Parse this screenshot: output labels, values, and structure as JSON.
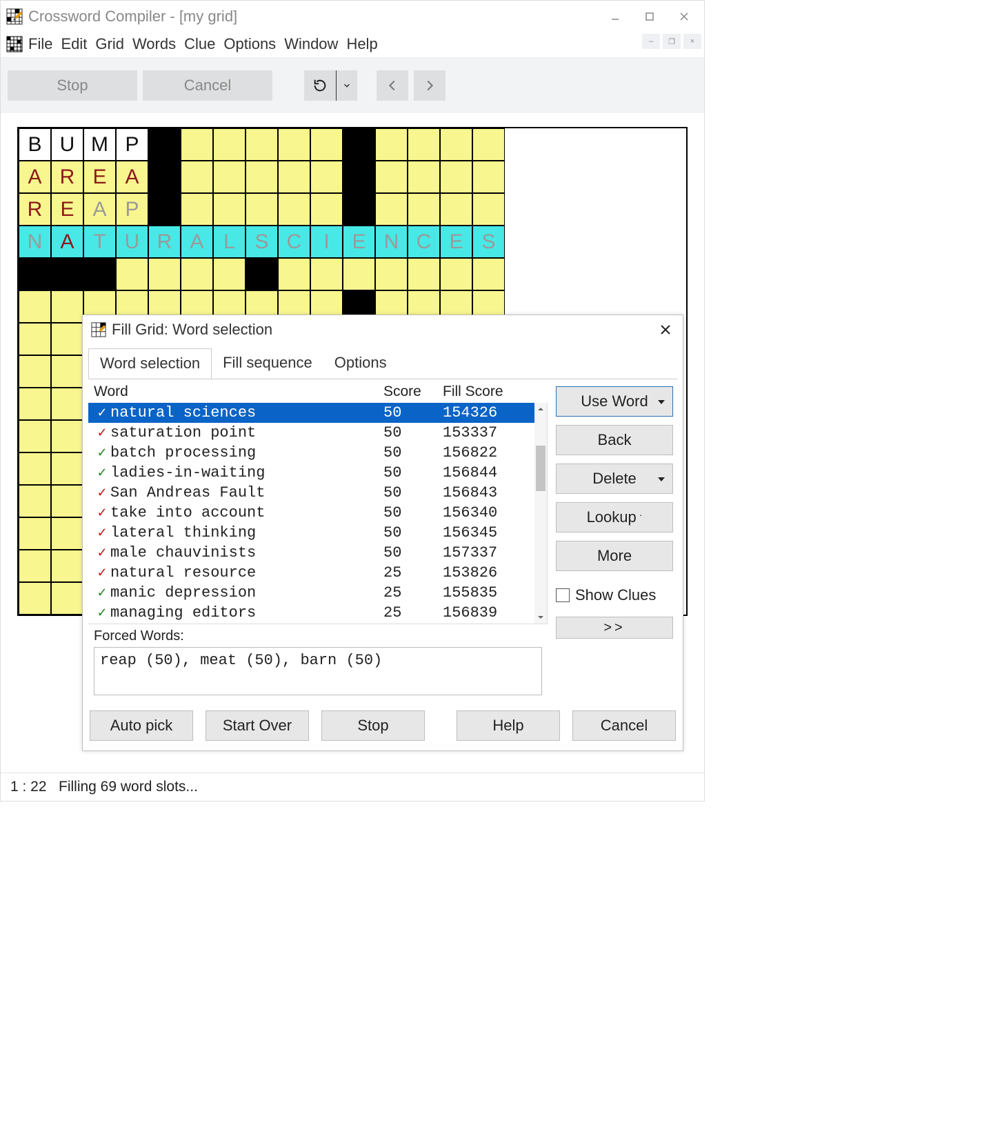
{
  "app": {
    "title": "Crossword Compiler - [my grid]"
  },
  "menu": {
    "items": [
      "File",
      "Edit",
      "Grid",
      "Words",
      "Clue",
      "Options",
      "Window",
      "Help"
    ]
  },
  "toolbar": {
    "stop": "Stop",
    "cancel": "Cancel"
  },
  "grid": {
    "rows": [
      [
        {
          "bg": "w",
          "t": "B",
          "c": "b"
        },
        {
          "bg": "w",
          "t": "U",
          "c": "b"
        },
        {
          "bg": "w",
          "t": "M",
          "c": "b"
        },
        {
          "bg": "w",
          "t": "P",
          "c": "b"
        },
        {
          "bg": "k"
        },
        {
          "bg": "y"
        },
        {
          "bg": "y"
        },
        {
          "bg": "y"
        },
        {
          "bg": "y"
        },
        {
          "bg": "y"
        },
        {
          "bg": "k"
        },
        {
          "bg": "y"
        },
        {
          "bg": "y"
        },
        {
          "bg": "y"
        },
        {
          "bg": "y"
        }
      ],
      [
        {
          "bg": "y",
          "t": "A",
          "c": "r"
        },
        {
          "bg": "y",
          "t": "R",
          "c": "r"
        },
        {
          "bg": "y",
          "t": "E",
          "c": "r"
        },
        {
          "bg": "y",
          "t": "A",
          "c": "r"
        },
        {
          "bg": "k"
        },
        {
          "bg": "y"
        },
        {
          "bg": "y"
        },
        {
          "bg": "y"
        },
        {
          "bg": "y"
        },
        {
          "bg": "y"
        },
        {
          "bg": "k"
        },
        {
          "bg": "y"
        },
        {
          "bg": "y"
        },
        {
          "bg": "y"
        },
        {
          "bg": "y"
        }
      ],
      [
        {
          "bg": "y",
          "t": "R",
          "c": "r"
        },
        {
          "bg": "y",
          "t": "E",
          "c": "r"
        },
        {
          "bg": "y",
          "t": "A",
          "c": "g"
        },
        {
          "bg": "y",
          "t": "P",
          "c": "g"
        },
        {
          "bg": "k"
        },
        {
          "bg": "y"
        },
        {
          "bg": "y"
        },
        {
          "bg": "y"
        },
        {
          "bg": "y"
        },
        {
          "bg": "y"
        },
        {
          "bg": "k"
        },
        {
          "bg": "y"
        },
        {
          "bg": "y"
        },
        {
          "bg": "y"
        },
        {
          "bg": "y"
        }
      ],
      [
        {
          "bg": "c",
          "t": "N",
          "c": "g"
        },
        {
          "bg": "c",
          "t": "A",
          "c": "r"
        },
        {
          "bg": "c",
          "t": "T",
          "c": "g"
        },
        {
          "bg": "c",
          "t": "U",
          "c": "g"
        },
        {
          "bg": "c",
          "t": "R",
          "c": "g"
        },
        {
          "bg": "c",
          "t": "A",
          "c": "g"
        },
        {
          "bg": "c",
          "t": "L",
          "c": "g"
        },
        {
          "bg": "c",
          "t": "S",
          "c": "g"
        },
        {
          "bg": "c",
          "t": "C",
          "c": "g"
        },
        {
          "bg": "c",
          "t": "I",
          "c": "g"
        },
        {
          "bg": "c",
          "t": "E",
          "c": "g"
        },
        {
          "bg": "c",
          "t": "N",
          "c": "g"
        },
        {
          "bg": "c",
          "t": "C",
          "c": "g"
        },
        {
          "bg": "c",
          "t": "E",
          "c": "g"
        },
        {
          "bg": "c",
          "t": "S",
          "c": "g"
        }
      ],
      [
        {
          "bg": "k"
        },
        {
          "bg": "k"
        },
        {
          "bg": "k"
        },
        {
          "bg": "y"
        },
        {
          "bg": "y"
        },
        {
          "bg": "y"
        },
        {
          "bg": "y"
        },
        {
          "bg": "k"
        },
        {
          "bg": "y"
        },
        {
          "bg": "y"
        },
        {
          "bg": "y"
        },
        {
          "bg": "y"
        },
        {
          "bg": "y"
        },
        {
          "bg": "y"
        },
        {
          "bg": "y"
        }
      ],
      [
        {
          "bg": "y"
        },
        {
          "bg": "y"
        },
        {
          "bg": "y"
        },
        {
          "bg": "y"
        },
        {
          "bg": "y"
        },
        {
          "bg": "y"
        },
        {
          "bg": "y"
        },
        {
          "bg": "y"
        },
        {
          "bg": "y"
        },
        {
          "bg": "y"
        },
        {
          "bg": "k"
        },
        {
          "bg": "y"
        },
        {
          "bg": "y"
        },
        {
          "bg": "y"
        },
        {
          "bg": "y"
        }
      ],
      [
        {
          "bg": "y"
        },
        {
          "bg": "y"
        },
        {
          "bg": "y"
        },
        {
          "bg": "y"
        },
        {
          "bg": "y"
        },
        {
          "bg": "k"
        },
        {
          "bg": "y"
        },
        {
          "bg": "y"
        },
        {
          "bg": "y"
        },
        {
          "bg": "y"
        },
        {
          "bg": "y"
        },
        {
          "bg": "y"
        },
        {
          "bg": "y"
        },
        {
          "bg": "y"
        },
        {
          "bg": "y"
        }
      ],
      [
        {
          "bg": "y"
        },
        {
          "bg": "y"
        },
        {
          "bg": "y"
        },
        {
          "bg": "y"
        },
        {
          "bg": "y"
        },
        {
          "bg": "y"
        },
        {
          "bg": "y"
        },
        {
          "bg": "k"
        },
        {
          "bg": "y"
        },
        {
          "bg": "y"
        },
        {
          "bg": "y"
        },
        {
          "bg": "y"
        },
        {
          "bg": "y"
        },
        {
          "bg": "y"
        },
        {
          "bg": "y"
        }
      ],
      [
        {
          "bg": "y"
        },
        {
          "bg": "y"
        },
        {
          "bg": "y"
        },
        {
          "bg": "y"
        },
        {
          "bg": "y"
        },
        {
          "bg": "y"
        },
        {
          "bg": "y"
        },
        {
          "bg": "y"
        },
        {
          "bg": "y"
        },
        {
          "bg": "k"
        },
        {
          "bg": "y"
        },
        {
          "bg": "y"
        },
        {
          "bg": "y"
        },
        {
          "bg": "y"
        },
        {
          "bg": "y"
        }
      ],
      [
        {
          "bg": "y"
        },
        {
          "bg": "y"
        },
        {
          "bg": "y"
        },
        {
          "bg": "y"
        },
        {
          "bg": "k"
        },
        {
          "bg": "y"
        },
        {
          "bg": "y"
        },
        {
          "bg": "y"
        },
        {
          "bg": "y"
        },
        {
          "bg": "y"
        },
        {
          "bg": "y"
        },
        {
          "bg": "y"
        },
        {
          "bg": "y"
        },
        {
          "bg": "y"
        },
        {
          "bg": "y"
        }
      ],
      [
        {
          "bg": "y"
        },
        {
          "bg": "y"
        },
        {
          "bg": "y"
        },
        {
          "bg": "y"
        },
        {
          "bg": "y"
        },
        {
          "bg": "y"
        },
        {
          "bg": "y"
        },
        {
          "bg": "k"
        },
        {
          "bg": "y"
        },
        {
          "bg": "y"
        },
        {
          "bg": "y"
        },
        {
          "bg": "y"
        },
        {
          "bg": "k"
        },
        {
          "bg": "k"
        },
        {
          "bg": "k"
        }
      ],
      [
        {
          "bg": "y"
        },
        {
          "bg": "y"
        },
        {
          "bg": "y"
        },
        {
          "bg": "y"
        },
        {
          "bg": "y"
        },
        {
          "bg": "y"
        },
        {
          "bg": "y"
        },
        {
          "bg": "y"
        },
        {
          "bg": "y"
        },
        {
          "bg": "y"
        },
        {
          "bg": "y"
        },
        {
          "bg": "y"
        },
        {
          "bg": "y"
        },
        {
          "bg": "y"
        },
        {
          "bg": "y"
        }
      ],
      [
        {
          "bg": "y"
        },
        {
          "bg": "y"
        },
        {
          "bg": "y"
        },
        {
          "bg": "y"
        },
        {
          "bg": "k"
        },
        {
          "bg": "y"
        },
        {
          "bg": "y"
        },
        {
          "bg": "y"
        },
        {
          "bg": "y"
        },
        {
          "bg": "y"
        },
        {
          "bg": "k"
        },
        {
          "bg": "y"
        },
        {
          "bg": "y"
        },
        {
          "bg": "y"
        },
        {
          "bg": "y"
        }
      ],
      [
        {
          "bg": "y"
        },
        {
          "bg": "y"
        },
        {
          "bg": "y"
        },
        {
          "bg": "y"
        },
        {
          "bg": "k"
        },
        {
          "bg": "y"
        },
        {
          "bg": "y"
        },
        {
          "bg": "y"
        },
        {
          "bg": "y"
        },
        {
          "bg": "y"
        },
        {
          "bg": "k"
        },
        {
          "bg": "y"
        },
        {
          "bg": "y"
        },
        {
          "bg": "y"
        },
        {
          "bg": "y"
        }
      ],
      [
        {
          "bg": "y"
        },
        {
          "bg": "y"
        },
        {
          "bg": "y"
        },
        {
          "bg": "y"
        },
        {
          "bg": "k"
        },
        {
          "bg": "y"
        },
        {
          "bg": "y"
        },
        {
          "bg": "y"
        },
        {
          "bg": "y"
        },
        {
          "bg": "y"
        },
        {
          "bg": "k"
        },
        {
          "bg": "y"
        },
        {
          "bg": "y"
        },
        {
          "bg": "y"
        },
        {
          "bg": "y"
        }
      ]
    ]
  },
  "dialog": {
    "title": "Fill Grid: Word selection",
    "tabs": [
      "Word selection",
      "Fill sequence",
      "Options"
    ],
    "activeTab": 0,
    "columns": {
      "word": "Word",
      "score": "Score",
      "fill": "Fill Score"
    },
    "rows": [
      {
        "mark": "green",
        "word": "natural sciences",
        "score": "50",
        "fill": "154326",
        "sel": true
      },
      {
        "mark": "red",
        "word": "saturation point",
        "score": "50",
        "fill": "153337"
      },
      {
        "mark": "green",
        "word": "batch processing",
        "score": "50",
        "fill": "156822"
      },
      {
        "mark": "green",
        "word": "ladies-in-waiting",
        "score": "50",
        "fill": "156844"
      },
      {
        "mark": "red",
        "word": "San Andreas Fault",
        "score": "50",
        "fill": "156843"
      },
      {
        "mark": "red",
        "word": "take into account",
        "score": "50",
        "fill": "156340"
      },
      {
        "mark": "red",
        "word": "lateral thinking",
        "score": "50",
        "fill": "156345"
      },
      {
        "mark": "red",
        "word": "male chauvinists",
        "score": "50",
        "fill": "157337"
      },
      {
        "mark": "red",
        "word": "natural resource",
        "score": "25",
        "fill": "153826"
      },
      {
        "mark": "green",
        "word": "manic depression",
        "score": "25",
        "fill": "155835"
      },
      {
        "mark": "green",
        "word": "managing editors",
        "score": "25",
        "fill": "156839"
      }
    ],
    "forcedLabel": "Forced Words:",
    "forced": "reap (50), meat (50), barn (50)",
    "side": {
      "useWord": "Use Word",
      "back": "Back",
      "delete": "Delete",
      "lookup": "Lookup",
      "more": "More",
      "showClues": "Show Clues",
      "expand": ">>"
    },
    "footer": {
      "autopick": "Auto pick",
      "startOver": "Start Over",
      "stop": "Stop",
      "help": "Help",
      "cancel": "Cancel"
    }
  },
  "status": {
    "time": "1 : 22",
    "msg": "Filling 69 word slots..."
  }
}
